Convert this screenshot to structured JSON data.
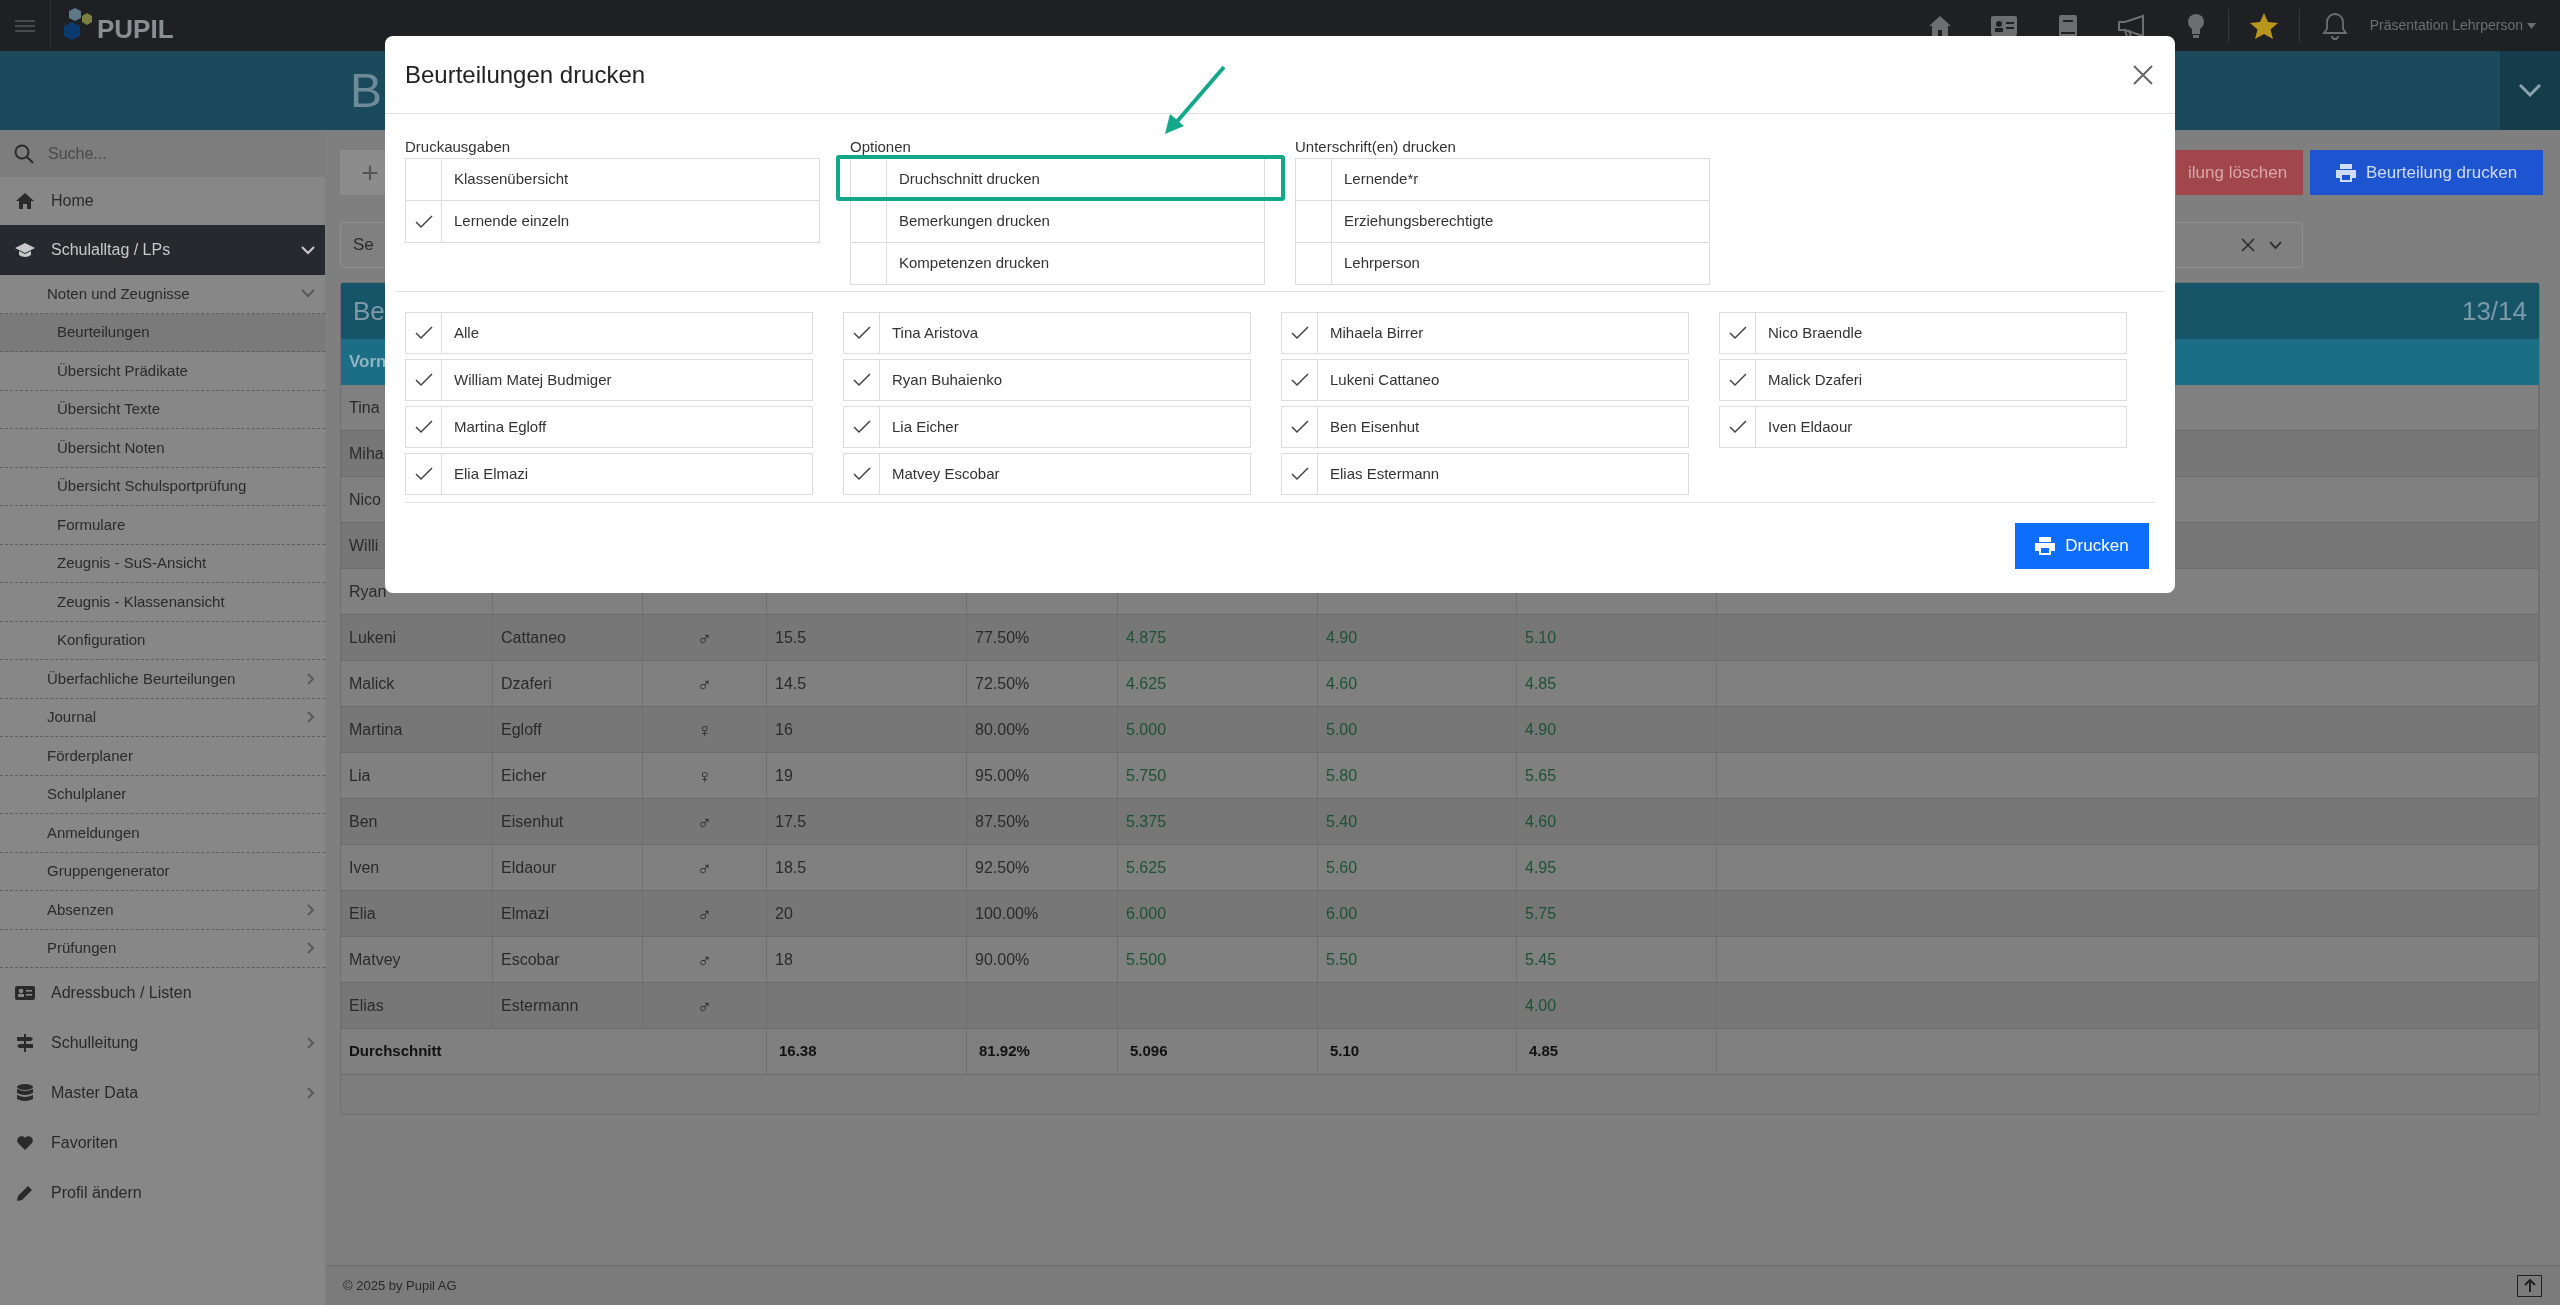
{
  "top_bar": {
    "logo": "PUPIL",
    "user": "Präsentation Lehrperson"
  },
  "header": {
    "title": "B"
  },
  "sidebar": {
    "search_placeholder": "Suche...",
    "items": [
      {
        "label": "Home",
        "active": false
      },
      {
        "label": "Schulalltag / LPs",
        "active": true,
        "expanded": true,
        "children": [
          {
            "label": "Noten und Zeugnisse",
            "expanded": true,
            "children": [
              {
                "label": "Beurteilungen",
                "selected": true
              },
              {
                "label": "Übersicht Prädikate",
                "selected": false
              },
              {
                "label": "Übersicht Texte",
                "selected": false
              },
              {
                "label": "Übersicht Noten",
                "selected": false
              },
              {
                "label": "Übersicht Schulsportprüfung",
                "selected": false
              },
              {
                "label": "Formulare",
                "selected": false
              },
              {
                "label": "Zeugnis - SuS-Ansicht",
                "selected": false
              },
              {
                "label": "Zeugnis - Klassenansicht",
                "selected": false
              },
              {
                "label": "Konfiguration",
                "selected": false
              }
            ]
          },
          {
            "label": "Überfachliche Beurteilungen",
            "expanded": false
          },
          {
            "label": "Journal",
            "expanded": false
          },
          {
            "label": "Förderplaner"
          },
          {
            "label": "Schulplaner"
          },
          {
            "label": "Anmeldungen"
          },
          {
            "label": "Gruppengenerator"
          },
          {
            "label": "Absenzen",
            "expanded": false
          },
          {
            "label": "Prüfungen",
            "expanded": false
          }
        ]
      },
      {
        "label": "Adressbuch / Listen",
        "active": false
      },
      {
        "label": "Schulleitung",
        "active": false,
        "expanded": false
      },
      {
        "label": "Master Data",
        "active": false,
        "expanded": false
      },
      {
        "label": "Favoriten",
        "active": false
      },
      {
        "label": "Profil ändern",
        "active": false
      }
    ]
  },
  "toolbar": {
    "add_button": "+",
    "delete_button": "ilung löschen",
    "print_button": "Beurteilung drucken"
  },
  "select": {
    "value": "Se"
  },
  "table": {
    "title": "Be",
    "count": "13/14",
    "first_header": "Vorn",
    "rows": [
      {
        "cells": [
          "Tina"
        ]
      },
      {
        "cells": [
          "Miha"
        ]
      },
      {
        "cells": [
          "Nico"
        ]
      },
      {
        "cells": [
          "Willi"
        ]
      },
      {
        "cells": [
          "Ryan"
        ]
      },
      {
        "cells": [
          "Lukeni",
          "Cattaneo",
          "♂",
          "15.5",
          "77.50%",
          "4.875",
          "4.90",
          "5.10"
        ]
      },
      {
        "cells": [
          "Malick",
          "Dzaferi",
          "♂",
          "14.5",
          "72.50%",
          "4.625",
          "4.60",
          "4.85"
        ]
      },
      {
        "cells": [
          "Martina",
          "Egloff",
          "♀",
          "16",
          "80.00%",
          "5.000",
          "5.00",
          "4.90"
        ]
      },
      {
        "cells": [
          "Lia",
          "Eicher",
          "♀",
          "19",
          "95.00%",
          "5.750",
          "5.80",
          "5.65"
        ]
      },
      {
        "cells": [
          "Ben",
          "Eisenhut",
          "♂",
          "17.5",
          "87.50%",
          "5.375",
          "5.40",
          "4.60"
        ]
      },
      {
        "cells": [
          "Iven",
          "Eldaour",
          "♂",
          "18.5",
          "92.50%",
          "5.625",
          "5.60",
          "4.95"
        ]
      },
      {
        "cells": [
          "Elia",
          "Elmazi",
          "♂",
          "20",
          "100.00%",
          "6.000",
          "6.00",
          "5.75"
        ]
      },
      {
        "cells": [
          "Matvey",
          "Escobar",
          "♂",
          "18",
          "90.00%",
          "5.500",
          "5.50",
          "5.45"
        ]
      },
      {
        "cells": [
          "Elias",
          "Estermann",
          "♂",
          "",
          "",
          "",
          "",
          "4.00"
        ]
      }
    ],
    "average": {
      "label": "Durchschnitt",
      "cells": [
        "16.38",
        "81.92%",
        "5.096",
        "5.10",
        "4.85"
      ]
    }
  },
  "footer": {
    "copyright": "© 2025 by Pupil AG"
  },
  "dialog": {
    "title": "Beurteilungen drucken",
    "groups": [
      {
        "label": "Druckausgaben",
        "options": [
          {
            "label": "Klassenübersicht",
            "checked": false
          },
          {
            "label": "Lernende einzeln",
            "checked": true
          }
        ]
      },
      {
        "label": "Optionen",
        "options": [
          {
            "label": "Druchschnitt drucken",
            "checked": false,
            "highlighted": true
          },
          {
            "label": "Bemerkungen drucken",
            "checked": false,
            "highlighted": false
          },
          {
            "label": "Kompetenzen drucken",
            "checked": false,
            "highlighted": false
          }
        ]
      },
      {
        "label": "Unterschrift(en) drucken",
        "options": [
          {
            "label": "Lernende*r",
            "checked": false
          },
          {
            "label": "Erziehungsberechtigte",
            "checked": false
          },
          {
            "label": "Lehrperson",
            "checked": false
          }
        ]
      }
    ],
    "students": [
      {
        "label": "Alle",
        "checked": true
      },
      {
        "label": "Tina Aristova",
        "checked": true
      },
      {
        "label": "Mihaela Birrer",
        "checked": true
      },
      {
        "label": "Nico Braendle",
        "checked": true
      },
      {
        "label": "William Matej Budmiger",
        "checked": true
      },
      {
        "label": "Ryan Buhaienko",
        "checked": true
      },
      {
        "label": "Lukeni Cattaneo",
        "checked": true
      },
      {
        "label": "Malick Dzaferi",
        "checked": true
      },
      {
        "label": "Martina Egloff",
        "checked": true
      },
      {
        "label": "Lia Eicher",
        "checked": true
      },
      {
        "label": "Ben Eisenhut",
        "checked": true
      },
      {
        "label": "Iven Eldaour",
        "checked": true
      },
      {
        "label": "Elia Elmazi",
        "checked": true
      },
      {
        "label": "Matvey Escobar",
        "checked": true
      },
      {
        "label": "Elias Estermann",
        "checked": true
      }
    ],
    "print_button": "Drucken"
  }
}
